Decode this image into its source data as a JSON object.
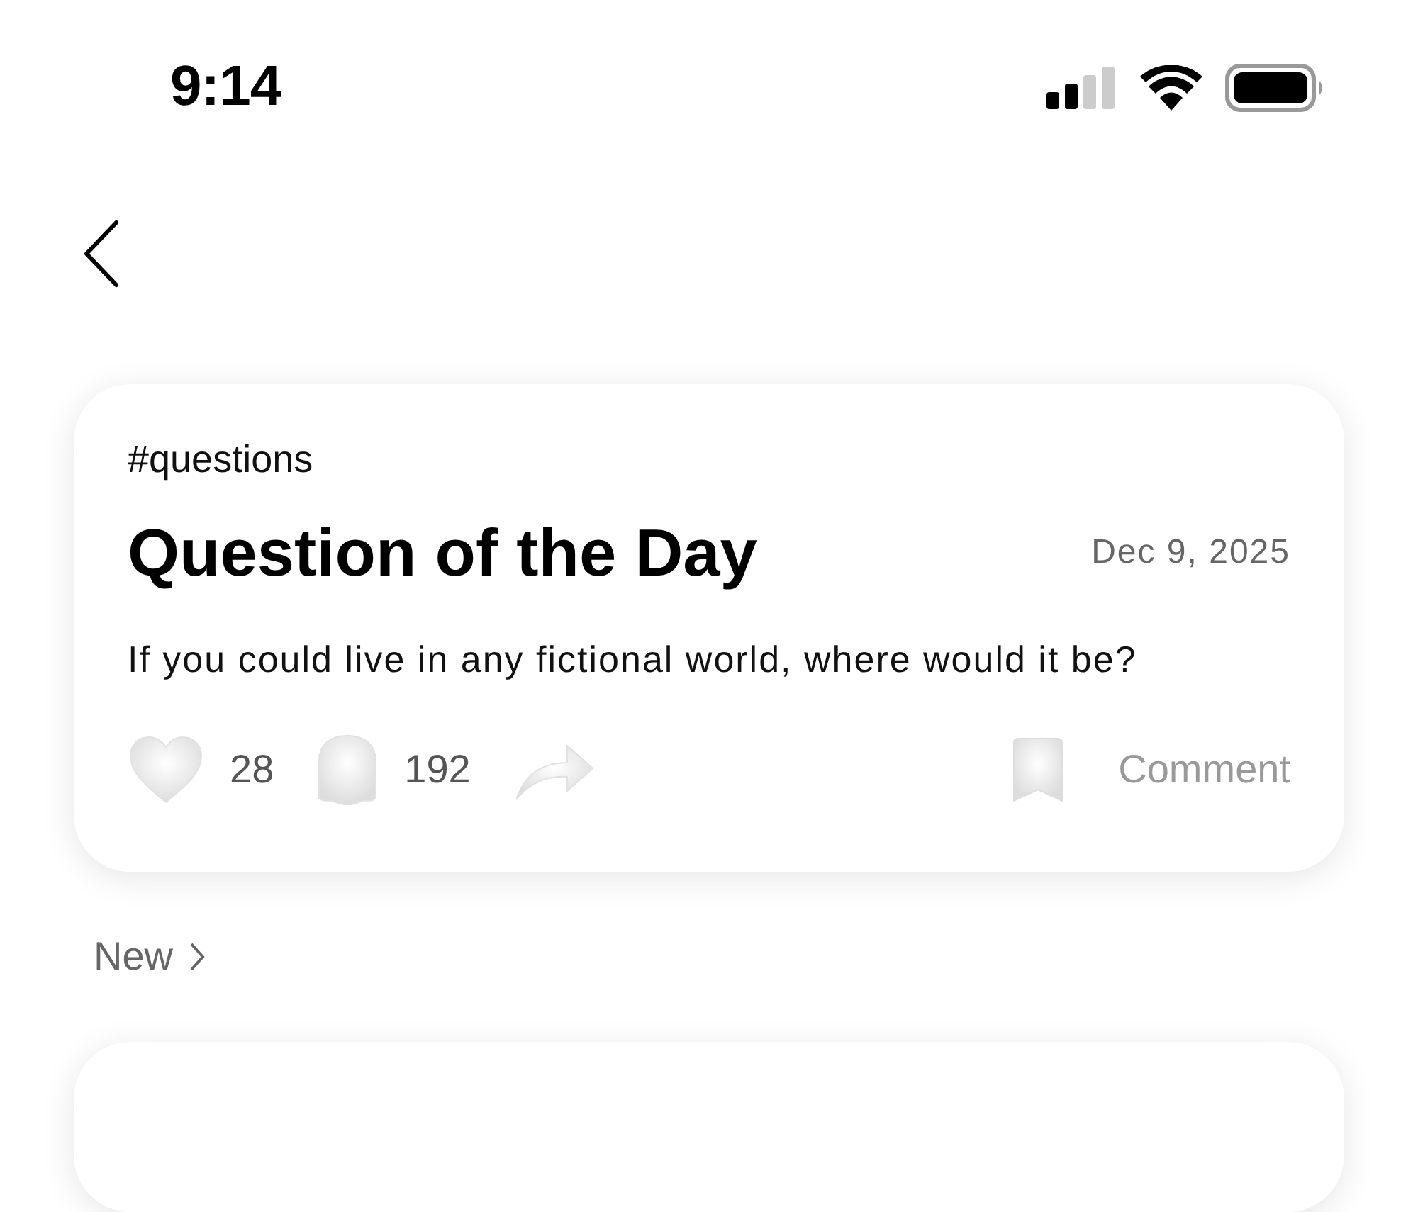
{
  "status_bar": {
    "time": "9:14"
  },
  "post": {
    "tag": "#questions",
    "title": "Question of the Day",
    "date": "Dec 9, 2025",
    "body": "If you could live in any fictional world, where would it be?",
    "actions": [
      {
        "kind": "like",
        "count": "28"
      },
      {
        "kind": "ghost",
        "count": "192"
      },
      {
        "kind": "share"
      }
    ],
    "comment": "Comment"
  },
  "section": {
    "label": "New"
  }
}
